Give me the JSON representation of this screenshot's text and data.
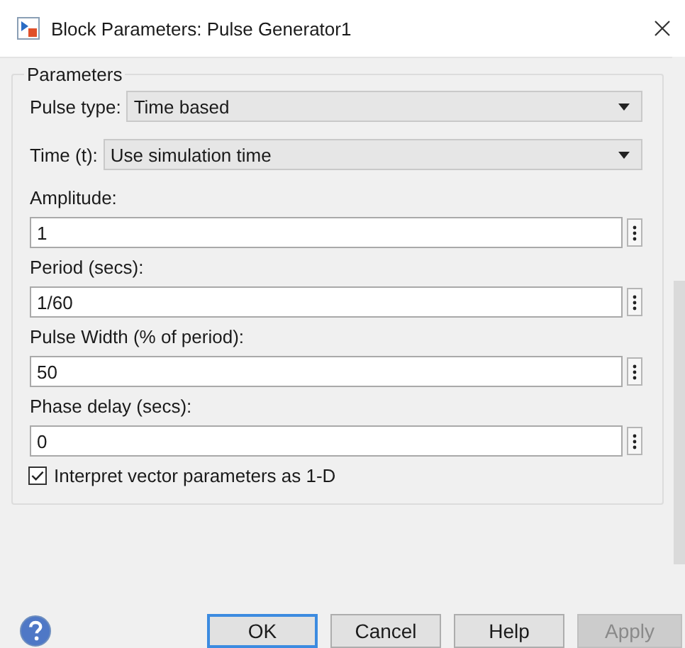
{
  "window": {
    "title": "Block Parameters: Pulse Generator1"
  },
  "group": {
    "title": "Parameters"
  },
  "dropdowns": [
    {
      "label": "Pulse type:",
      "value": "Time based"
    },
    {
      "label": "Time (t):",
      "value": "Use simulation time"
    }
  ],
  "fields": [
    {
      "label": "Amplitude:",
      "value": "1"
    },
    {
      "label": "Period (secs):",
      "value": "1/60"
    },
    {
      "label": "Pulse Width (% of period):",
      "value": "50"
    },
    {
      "label": "Phase delay (secs):",
      "value": "0"
    }
  ],
  "checkbox": {
    "label": "Interpret vector parameters as 1-D",
    "checked": true
  },
  "buttons": [
    {
      "label": "OK",
      "focused": true,
      "disabled": false
    },
    {
      "label": "Cancel",
      "focused": false,
      "disabled": false
    },
    {
      "label": "Help",
      "focused": false,
      "disabled": false
    },
    {
      "label": "Apply",
      "focused": false,
      "disabled": true
    }
  ]
}
